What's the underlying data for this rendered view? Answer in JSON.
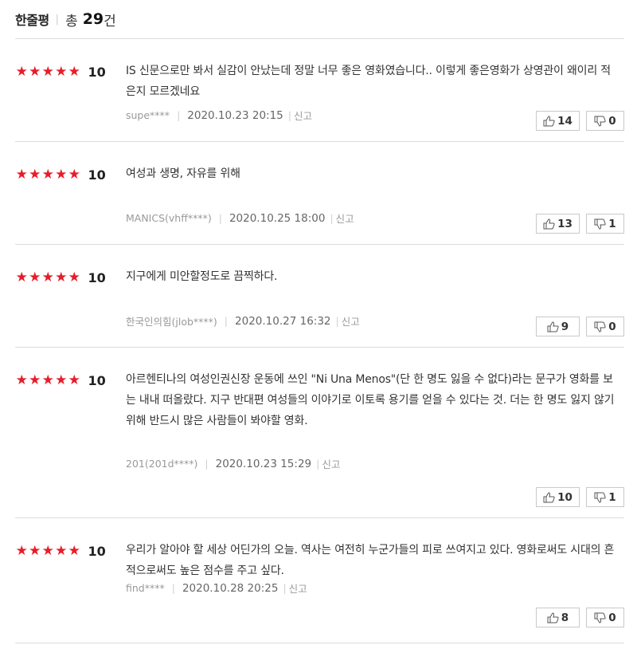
{
  "header": {
    "title": "한줄평",
    "separator": "|",
    "total_prefix": "총",
    "total_count": "29",
    "total_suffix": "건"
  },
  "colors": {
    "star": "#e81c2a",
    "border": "#dcdcdc"
  },
  "reviews": [
    {
      "stars": 5,
      "score": "10",
      "text": "IS 신문으로만 봐서 실감이 안났는데 정말 너무 좋은 영화였습니다.. 이렇게 좋은영화가 상영관이 왜이리 적은지 모르겠네요",
      "user": "supe****",
      "date": "2020.10.23 20:15",
      "report": "신고",
      "likes": "14",
      "dislikes": "0"
    },
    {
      "stars": 5,
      "score": "10",
      "text": "여성과 생명, 자유를 위해",
      "user": "MANICS(vhff****)",
      "date": "2020.10.25 18:00",
      "report": "신고",
      "likes": "13",
      "dislikes": "1"
    },
    {
      "stars": 5,
      "score": "10",
      "text": "지구에게 미안할정도로 끔찍하다.",
      "user": "한국인의힘(jlob****)",
      "date": "2020.10.27 16:32",
      "report": "신고",
      "likes": "9",
      "dislikes": "0"
    },
    {
      "stars": 5,
      "score": "10",
      "text": "아르헨티나의 여성인권신장 운동에 쓰인 \"Ni Una Menos\"(단 한 명도 잃을 수 없다)라는 문구가 영화를 보는 내내 떠올랐다. 지구 반대편 여성들의 이야기로 이토록 용기를 얻을 수 있다는 것. 더는 한 명도 잃지 않기 위해 반드시 많은 사람들이 봐야할 영화.",
      "user": "201(201d****)",
      "date": "2020.10.23 15:29",
      "report": "신고",
      "likes": "10",
      "dislikes": "1"
    },
    {
      "stars": 5,
      "score": "10",
      "text": "우리가 알아야 할 세상 어딘가의 오늘. 역사는 여전히 누군가들의 피로 쓰여지고 있다. 영화로써도 시대의 흔적으로써도 높은 점수를 주고 싶다.",
      "user": "find****",
      "date": "2020.10.28 20:25",
      "report": "신고",
      "likes": "8",
      "dislikes": "0"
    }
  ]
}
